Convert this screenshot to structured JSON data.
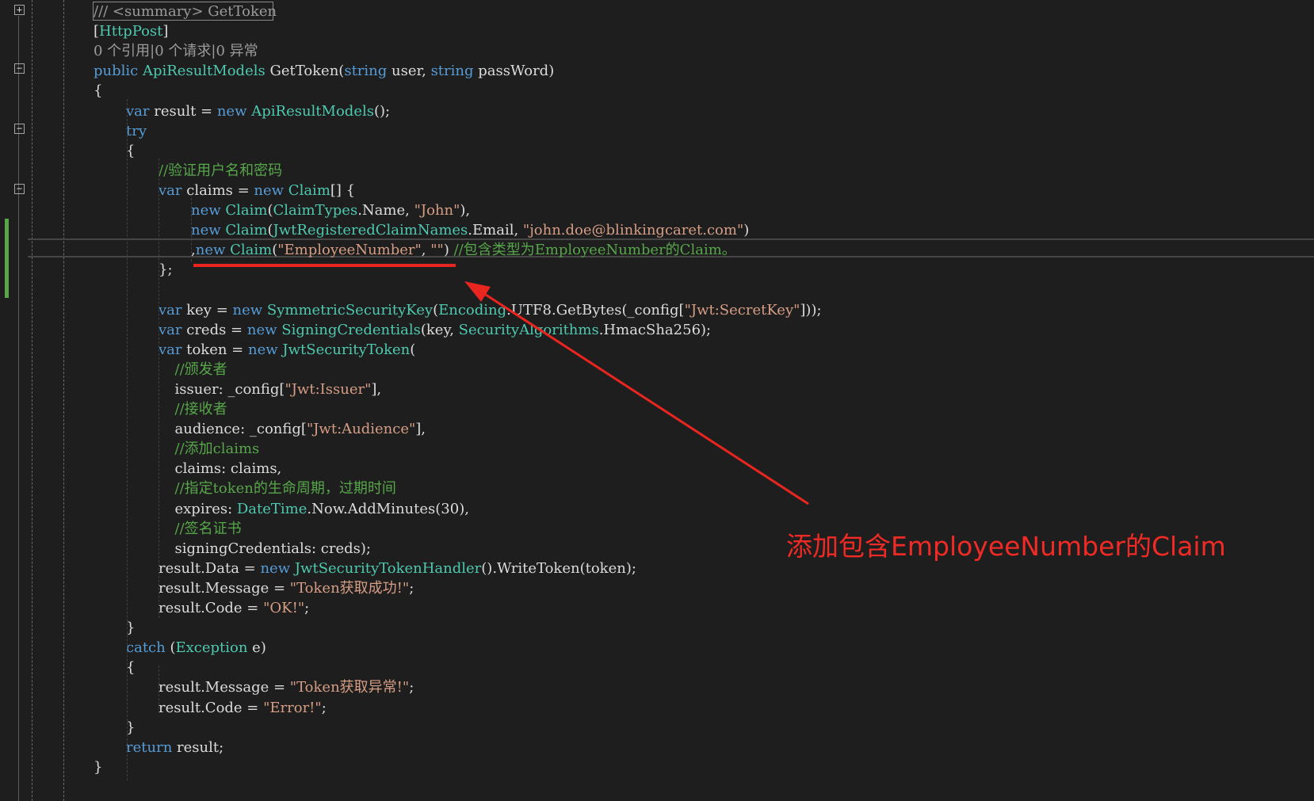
{
  "editor": {
    "lines": [
      {
        "indent": 0,
        "segments": [
          {
            "c": "gy",
            "t": "/// <summary> GetToken"
          }
        ]
      },
      {
        "indent": 0,
        "segments": [
          {
            "c": "txt",
            "t": "["
          },
          {
            "c": "ty",
            "t": "HttpPost"
          },
          {
            "c": "txt",
            "t": "]"
          }
        ]
      },
      {
        "indent": 0,
        "segments": [
          {
            "c": "gy",
            "t": "0 个引用|0 个请求|0 异常"
          }
        ]
      },
      {
        "indent": 0,
        "segments": [
          {
            "c": "kw",
            "t": "public"
          },
          {
            "c": "txt",
            "t": " "
          },
          {
            "c": "ty",
            "t": "ApiResultModels"
          },
          {
            "c": "txt",
            "t": " GetToken("
          },
          {
            "c": "kw",
            "t": "string"
          },
          {
            "c": "txt",
            "t": " user, "
          },
          {
            "c": "kw",
            "t": "string"
          },
          {
            "c": "txt",
            "t": " passWord)"
          }
        ]
      },
      {
        "indent": 0,
        "segments": [
          {
            "c": "txt",
            "t": "{"
          }
        ]
      },
      {
        "indent": 1,
        "segments": [
          {
            "c": "kw",
            "t": "var"
          },
          {
            "c": "txt",
            "t": " result = "
          },
          {
            "c": "kw",
            "t": "new"
          },
          {
            "c": "txt",
            "t": " "
          },
          {
            "c": "ty",
            "t": "ApiResultModels"
          },
          {
            "c": "txt",
            "t": "();"
          }
        ]
      },
      {
        "indent": 1,
        "segments": [
          {
            "c": "kw",
            "t": "try"
          }
        ]
      },
      {
        "indent": 1,
        "segments": [
          {
            "c": "txt",
            "t": "{"
          }
        ]
      },
      {
        "indent": 2,
        "segments": [
          {
            "c": "cm",
            "t": "//验证用户名和密码"
          }
        ]
      },
      {
        "indent": 2,
        "segments": [
          {
            "c": "kw",
            "t": "var"
          },
          {
            "c": "txt",
            "t": " claims = "
          },
          {
            "c": "kw",
            "t": "new"
          },
          {
            "c": "txt",
            "t": " "
          },
          {
            "c": "ty",
            "t": "Claim"
          },
          {
            "c": "txt",
            "t": "[] {"
          }
        ]
      },
      {
        "indent": 3,
        "segments": [
          {
            "c": "kw",
            "t": "new"
          },
          {
            "c": "txt",
            "t": " "
          },
          {
            "c": "ty",
            "t": "Claim"
          },
          {
            "c": "txt",
            "t": "("
          },
          {
            "c": "ty",
            "t": "ClaimTypes"
          },
          {
            "c": "txt",
            "t": ".Name, "
          },
          {
            "c": "st",
            "t": "\"John\""
          },
          {
            "c": "txt",
            "t": "),"
          }
        ]
      },
      {
        "indent": 3,
        "segments": [
          {
            "c": "kw",
            "t": "new"
          },
          {
            "c": "txt",
            "t": " "
          },
          {
            "c": "ty",
            "t": "Claim"
          },
          {
            "c": "txt",
            "t": "("
          },
          {
            "c": "ty",
            "t": "JwtRegisteredClaimNames"
          },
          {
            "c": "txt",
            "t": ".Email, "
          },
          {
            "c": "st",
            "t": "\"john.doe@blinkingcaret.com\""
          },
          {
            "c": "txt",
            "t": ")"
          }
        ]
      },
      {
        "indent": 3,
        "segments": [
          {
            "c": "txt",
            "t": ","
          },
          {
            "c": "kw",
            "t": "new"
          },
          {
            "c": "txt",
            "t": " "
          },
          {
            "c": "ty",
            "t": "Claim"
          },
          {
            "c": "txt",
            "t": "("
          },
          {
            "c": "st",
            "t": "\"EmployeeNumber\""
          },
          {
            "c": "txt",
            "t": ", "
          },
          {
            "c": "st",
            "t": "\"\""
          },
          {
            "c": "txt",
            "t": ") "
          },
          {
            "c": "cm",
            "t": "//包含类型为EmployeeNumber的Claim。"
          }
        ]
      },
      {
        "indent": 2,
        "segments": [
          {
            "c": "txt",
            "t": "};"
          }
        ]
      },
      {
        "indent": 0,
        "segments": []
      },
      {
        "indent": 2,
        "segments": [
          {
            "c": "kw",
            "t": "var"
          },
          {
            "c": "txt",
            "t": " key = "
          },
          {
            "c": "kw",
            "t": "new"
          },
          {
            "c": "txt",
            "t": " "
          },
          {
            "c": "ty",
            "t": "SymmetricSecurityKey"
          },
          {
            "c": "txt",
            "t": "("
          },
          {
            "c": "ty",
            "t": "Encoding"
          },
          {
            "c": "txt",
            "t": ".UTF8.GetBytes(_config["
          },
          {
            "c": "st",
            "t": "\"Jwt:SecretKey\""
          },
          {
            "c": "txt",
            "t": "]));"
          }
        ]
      },
      {
        "indent": 2,
        "segments": [
          {
            "c": "kw",
            "t": "var"
          },
          {
            "c": "txt",
            "t": " creds = "
          },
          {
            "c": "kw",
            "t": "new"
          },
          {
            "c": "txt",
            "t": " "
          },
          {
            "c": "ty",
            "t": "SigningCredentials"
          },
          {
            "c": "txt",
            "t": "(key, "
          },
          {
            "c": "ty",
            "t": "SecurityAlgorithms"
          },
          {
            "c": "txt",
            "t": ".HmacSha256);"
          }
        ]
      },
      {
        "indent": 2,
        "segments": [
          {
            "c": "kw",
            "t": "var"
          },
          {
            "c": "txt",
            "t": " token = "
          },
          {
            "c": "kw",
            "t": "new"
          },
          {
            "c": "txt",
            "t": " "
          },
          {
            "c": "ty",
            "t": "JwtSecurityToken"
          },
          {
            "c": "txt",
            "t": "("
          }
        ]
      },
      {
        "indent": 2.5,
        "segments": [
          {
            "c": "cm",
            "t": "//颁发者"
          }
        ]
      },
      {
        "indent": 2.5,
        "segments": [
          {
            "c": "txt",
            "t": "issuer: _config["
          },
          {
            "c": "st",
            "t": "\"Jwt:Issuer\""
          },
          {
            "c": "txt",
            "t": "],"
          }
        ]
      },
      {
        "indent": 2.5,
        "segments": [
          {
            "c": "cm",
            "t": "//接收者"
          }
        ]
      },
      {
        "indent": 2.5,
        "segments": [
          {
            "c": "txt",
            "t": "audience: _config["
          },
          {
            "c": "st",
            "t": "\"Jwt:Audience\""
          },
          {
            "c": "txt",
            "t": "],"
          }
        ]
      },
      {
        "indent": 2.5,
        "segments": [
          {
            "c": "cm",
            "t": "//添加claims"
          }
        ]
      },
      {
        "indent": 2.5,
        "segments": [
          {
            "c": "txt",
            "t": "claims: claims,"
          }
        ]
      },
      {
        "indent": 2.5,
        "segments": [
          {
            "c": "cm",
            "t": "//指定token的生命周期，过期时间"
          }
        ]
      },
      {
        "indent": 2.5,
        "segments": [
          {
            "c": "txt",
            "t": "expires: "
          },
          {
            "c": "ty",
            "t": "DateTime"
          },
          {
            "c": "txt",
            "t": ".Now.AddMinutes(30),"
          }
        ]
      },
      {
        "indent": 2.5,
        "segments": [
          {
            "c": "cm",
            "t": "//签名证书"
          }
        ]
      },
      {
        "indent": 2.5,
        "segments": [
          {
            "c": "txt",
            "t": "signingCredentials: creds);"
          }
        ]
      },
      {
        "indent": 2,
        "segments": [
          {
            "c": "txt",
            "t": "result.Data = "
          },
          {
            "c": "kw",
            "t": "new"
          },
          {
            "c": "txt",
            "t": " "
          },
          {
            "c": "ty",
            "t": "JwtSecurityTokenHandler"
          },
          {
            "c": "txt",
            "t": "().WriteToken(token);"
          }
        ]
      },
      {
        "indent": 2,
        "segments": [
          {
            "c": "txt",
            "t": "result.Message = "
          },
          {
            "c": "st",
            "t": "\"Token获取成功!\""
          },
          {
            "c": "txt",
            "t": ";"
          }
        ]
      },
      {
        "indent": 2,
        "segments": [
          {
            "c": "txt",
            "t": "result.Code = "
          },
          {
            "c": "st",
            "t": "\"OK!\""
          },
          {
            "c": "txt",
            "t": ";"
          }
        ]
      },
      {
        "indent": 1,
        "segments": [
          {
            "c": "txt",
            "t": "}"
          }
        ]
      },
      {
        "indent": 1,
        "segments": [
          {
            "c": "kw",
            "t": "catch"
          },
          {
            "c": "txt",
            "t": " ("
          },
          {
            "c": "ty",
            "t": "Exception"
          },
          {
            "c": "txt",
            "t": " e)"
          }
        ]
      },
      {
        "indent": 1,
        "segments": [
          {
            "c": "txt",
            "t": "{"
          }
        ]
      },
      {
        "indent": 2,
        "segments": [
          {
            "c": "txt",
            "t": "result.Message = "
          },
          {
            "c": "st",
            "t": "\"Token获取异常!\""
          },
          {
            "c": "txt",
            "t": ";"
          }
        ]
      },
      {
        "indent": 2,
        "segments": [
          {
            "c": "txt",
            "t": "result.Code = "
          },
          {
            "c": "st",
            "t": "\"Error!\""
          },
          {
            "c": "txt",
            "t": ";"
          }
        ]
      },
      {
        "indent": 1,
        "segments": [
          {
            "c": "txt",
            "t": "}"
          }
        ]
      },
      {
        "indent": 1,
        "segments": [
          {
            "c": "kw",
            "t": "return"
          },
          {
            "c": "txt",
            "t": " result;"
          }
        ]
      },
      {
        "indent": 0,
        "segments": [
          {
            "c": "txt",
            "t": "}"
          }
        ]
      }
    ]
  },
  "folds": [
    {
      "symbol": "+",
      "name": "expand-summary-icon"
    },
    {
      "symbol": "−",
      "name": "collapse-method-icon"
    },
    {
      "symbol": "−",
      "name": "collapse-try-icon"
    },
    {
      "symbol": "−",
      "name": "collapse-claims-icon"
    }
  ],
  "annotation": {
    "text": "添加包含EmployeeNumber的Claim",
    "color": "#f02a25"
  },
  "colors": {
    "background": "#1e1e1e",
    "keyword": "#569cd6",
    "type": "#4ec9b0",
    "string": "#d69d85",
    "comment": "#57a64a",
    "text": "#dcdcdc",
    "codelens": "#9b9b9b"
  }
}
